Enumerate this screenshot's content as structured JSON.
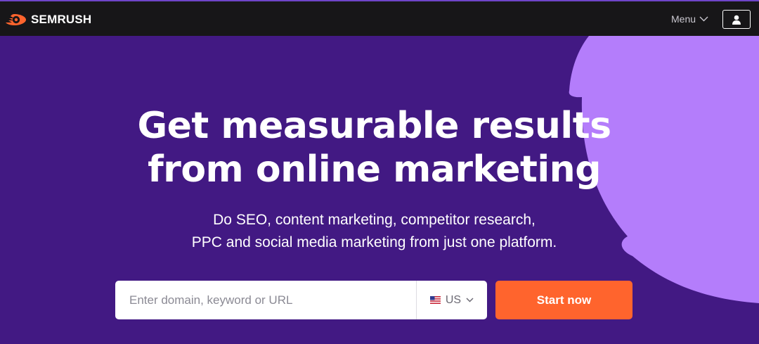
{
  "header": {
    "logo_text": "SEMRUSH",
    "menu_label": "Menu",
    "icons": {
      "logo": "semrush-flame-icon",
      "menu_caret": "chevron-down-icon",
      "user": "user-icon"
    }
  },
  "hero": {
    "headline_line1": "Get measurable results",
    "headline_line2": "from online marketing",
    "sub_line1": "Do SEO, content marketing, competitor research,",
    "sub_line2": "PPC and social media marketing from just one platform."
  },
  "search": {
    "placeholder": "Enter domain, keyword or URL",
    "database_selected": "US",
    "database_icon": "us-flag-icon",
    "cta_label": "Start now"
  },
  "colors": {
    "background": "#421983",
    "topbar": "#171618",
    "accent_shape": "#b47dfb",
    "cta": "#ff642d"
  }
}
